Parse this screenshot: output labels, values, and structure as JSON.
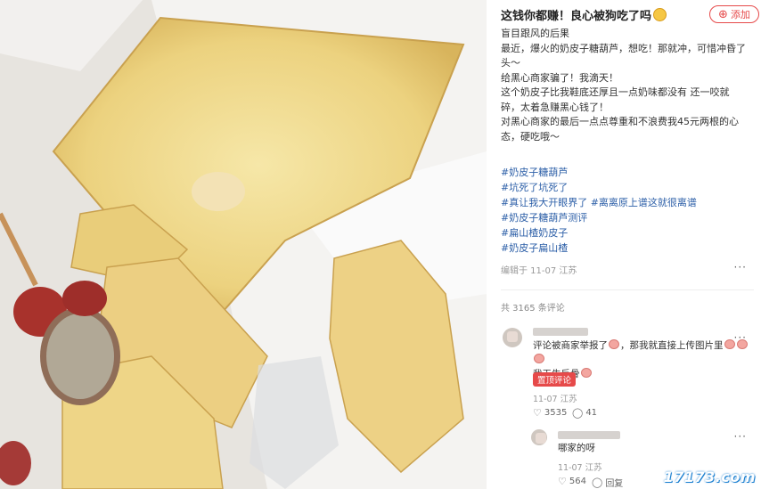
{
  "post": {
    "title": "这钱你都赚！良心被狗吃了吗",
    "follow_label": "添加",
    "body_lines": [
      "盲目跟风的后果",
      "最近，爆火的奶皮子糖葫芦，想吃！那就冲，可惜冲昏了头～",
      "给黑心商家骗了！我滴天！",
      "这个奶皮子比我鞋底还厚且一点奶味都没有 还一咬就碎，太着急赚黑心钱了！",
      "对黑心商家的最后一点点尊重和不浪费我45元两根的心态，硬吃哦～"
    ],
    "tags": [
      [
        "#奶皮子糖葫芦"
      ],
      [
        "#坑死了坑死了"
      ],
      [
        "#真让我大开眼界了",
        "#离离原上谱这就很离谱"
      ],
      [
        "#奶皮子糖葫芦测评"
      ],
      [
        "#扁山楂奶皮子"
      ],
      [
        "#奶皮子扁山楂"
      ]
    ],
    "meta": "编辑于 11-07 江苏"
  },
  "comments_count": "共 3165 条评论",
  "comments": [
    {
      "text_lines": [
        "评论被商家举报了",
        "，那我就直接上传图片里",
        "我天生反骨"
      ],
      "pinned_label": "置顶评论",
      "meta": "11-07 江苏",
      "likes": "3535",
      "replies": "41"
    },
    {
      "text": "哪家的呀",
      "meta": "11-07 江苏",
      "likes": "564",
      "reply_label": "回复"
    }
  ],
  "watermark": "17173.com",
  "icons": [
    "smile-emoji-icon",
    "plus-icon",
    "more-icon",
    "heart-icon",
    "comment-icon",
    "pig-emoji-icon"
  ],
  "colors": {
    "accent": "#e64a4a",
    "tag": "#2b5ea7"
  }
}
